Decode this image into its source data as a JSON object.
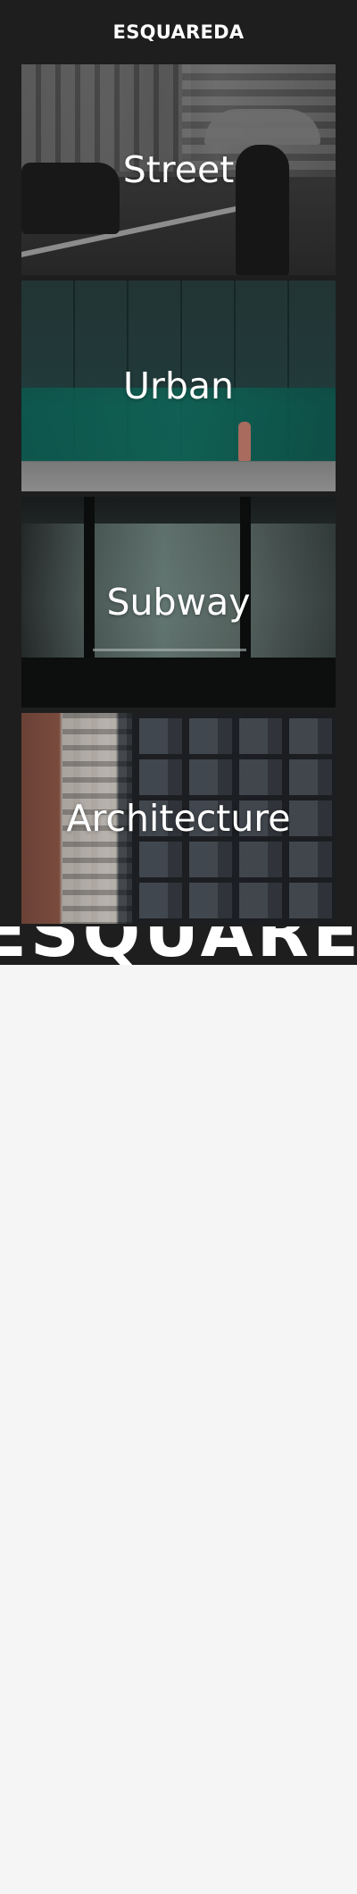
{
  "header": {
    "brand": "ESQUAREDA"
  },
  "gallery": {
    "cards": [
      {
        "title": "Street"
      },
      {
        "title": "Urban"
      },
      {
        "title": "Subway"
      },
      {
        "title": "Architecture"
      }
    ]
  },
  "footer": {
    "marquee": "ESQUAREDA"
  }
}
